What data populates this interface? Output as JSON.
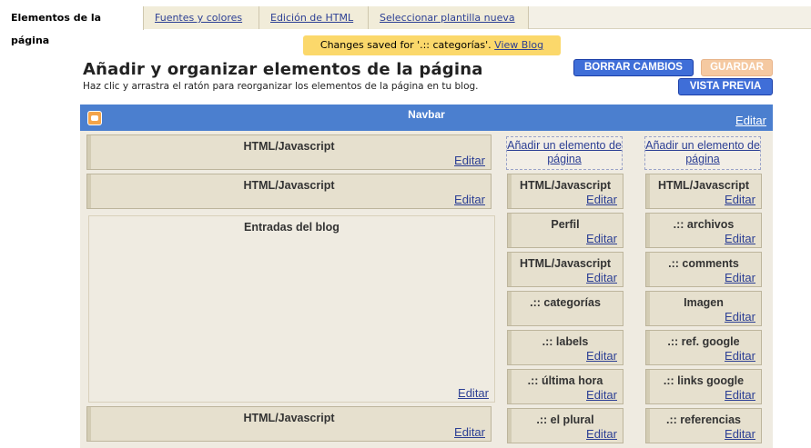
{
  "tabs": [
    {
      "label": "Elementos de la página",
      "active": true
    },
    {
      "label": "Fuentes y colores",
      "active": false
    },
    {
      "label": "Edición de HTML",
      "active": false
    },
    {
      "label": "Seleccionar plantilla nueva",
      "active": false
    }
  ],
  "notice": {
    "text": "Changes saved for '.:: categorías'.",
    "link": "View Blog"
  },
  "heading": {
    "title": "Añadir y organizar elementos de la página",
    "subtitle": "Haz clic y arrastra el ratón para reorganizar los elementos de la página en tu blog."
  },
  "buttons": {
    "clear": "BORRAR CAMBIOS",
    "save": "GUARDAR",
    "preview": "VISTA PREVIA"
  },
  "navbar": {
    "title": "Navbar",
    "edit": "Editar"
  },
  "main_column": [
    {
      "title": "HTML/Javascript",
      "edit": "Editar"
    },
    {
      "title": "HTML/Javascript",
      "edit": "Editar"
    },
    {
      "title": "Entradas del blog",
      "edit": "Editar"
    },
    {
      "title": "HTML/Javascript",
      "edit": "Editar"
    }
  ],
  "sidebar1": {
    "add": "Añadir un elemento de página",
    "items": [
      {
        "title": "HTML/Javascript",
        "edit": "Editar"
      },
      {
        "title": "Perfil",
        "edit": "Editar"
      },
      {
        "title": "HTML/Javascript",
        "edit": "Editar"
      },
      {
        "title": ".:: categorías",
        "edit": ""
      },
      {
        "title": ".:: labels",
        "edit": "Editar"
      },
      {
        "title": ".:: última hora",
        "edit": "Editar"
      },
      {
        "title": ".:: el plural",
        "edit": "Editar"
      }
    ]
  },
  "sidebar2": {
    "add": "Añadir un elemento de página",
    "items": [
      {
        "title": "HTML/Javascript",
        "edit": "Editar"
      },
      {
        "title": ".:: archivos",
        "edit": "Editar"
      },
      {
        "title": ".:: comments",
        "edit": "Editar"
      },
      {
        "title": "Imagen",
        "edit": "Editar"
      },
      {
        "title": ".:: ref. google",
        "edit": "Editar"
      },
      {
        "title": ".:: links google",
        "edit": "Editar"
      },
      {
        "title": ".:: referencias",
        "edit": "Editar"
      }
    ]
  }
}
